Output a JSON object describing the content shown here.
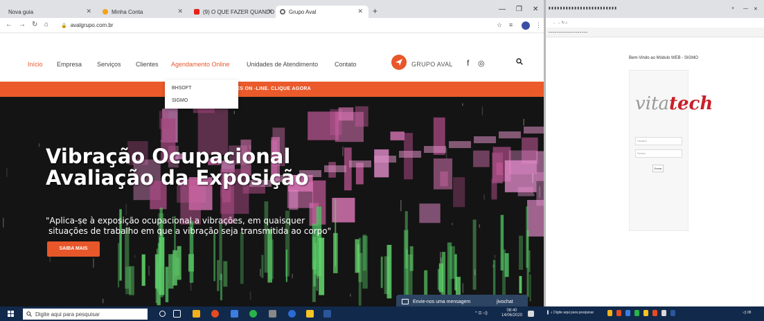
{
  "left_browser": {
    "tabs": [
      {
        "title": "Nova guia",
        "favicon_color": "#8a8a8a"
      },
      {
        "title": "Minha Conta",
        "favicon_color": "#f4a01b"
      },
      {
        "title": "(9) O QUE FAZER QUANDO",
        "favicon_color": "#e62117"
      },
      {
        "title": "Grupo Aval",
        "favicon_color": "#666666"
      }
    ],
    "url": "avalgrupo.com.br"
  },
  "site": {
    "nav": [
      "Início",
      "Empresa",
      "Serviços",
      "Clientes",
      "Agendamento Online",
      "Unidades de Atendimento",
      "Contato"
    ],
    "logo_text": "GRUPO AVAL",
    "banner_text": "...LTORES ON -LINE. CLIQUE AGORA",
    "dropdown": [
      "BHSOFT",
      "SIGMO"
    ],
    "hero": {
      "title_line1": "Vibração Ocupacional",
      "title_line2": "Avaliação da Exposição",
      "quote_line1": "\"Aplica-se à exposição ocupacional a vibrações, em quaisquer",
      "quote_line2": "situações de trabalho em que a vibração seja transmitida ao corpo\"",
      "button": "SAIBA MAIS"
    },
    "chat": {
      "text": "Envie-nos uma mensagem",
      "brand": "jivochat"
    }
  },
  "right_browser": {
    "welcome": "Bem-Vindo ao Módulo WEB - SIGMO",
    "logo_part1": "vita",
    "logo_part2": "tech",
    "username_placeholder": "Usuário",
    "password_placeholder": "Senha",
    "login_button": "Entrar"
  },
  "taskbar": {
    "search_placeholder": "Digite aqui para pesquisar",
    "right_app_label": "Digite aqui para pesquisar",
    "time": "08:40",
    "date": "14/06/2020"
  },
  "colors": {
    "brand": "#e8572a",
    "taskbar": "#11294b",
    "chat": "#2d4563",
    "vitatech_red": "#c8202a"
  }
}
